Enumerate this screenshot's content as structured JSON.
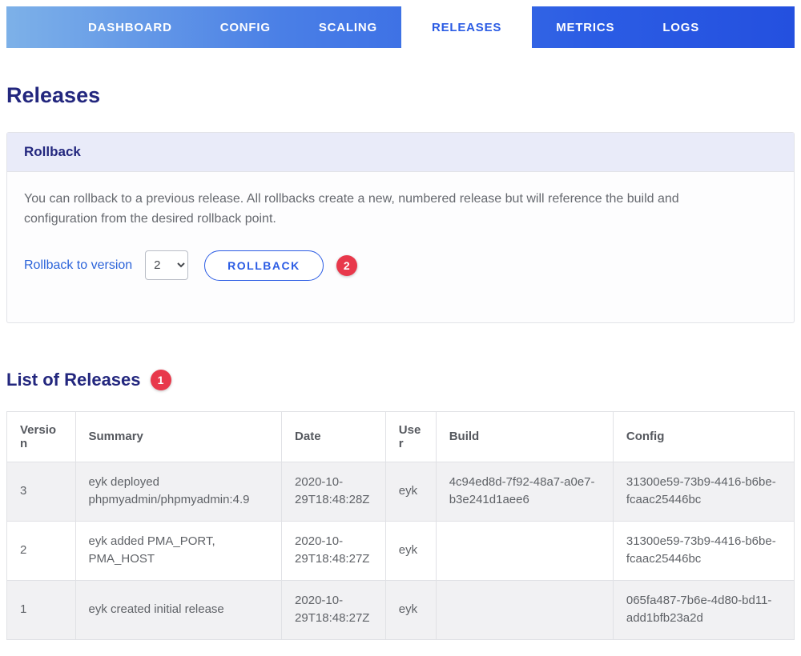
{
  "nav": {
    "items": [
      {
        "label": "DASHBOARD",
        "active": false
      },
      {
        "label": "CONFIG",
        "active": false
      },
      {
        "label": "SCALING",
        "active": false
      },
      {
        "label": "RELEASES",
        "active": true
      },
      {
        "label": "METRICS",
        "active": false
      },
      {
        "label": "LOGS",
        "active": false
      }
    ]
  },
  "page": {
    "title": "Releases"
  },
  "rollback_card": {
    "header": "Rollback",
    "description": "You can rollback to a previous release. All rollbacks create a new, numbered release but will reference the build and configuration from the desired rollback point.",
    "label": "Rollback to version",
    "selected_version": "2",
    "button_label": "ROLLBACK",
    "badge": "2"
  },
  "releases_section": {
    "title": "List of Releases",
    "badge": "1",
    "table": {
      "headers": [
        "Version",
        "Summary",
        "Date",
        "User",
        "Build",
        "Config"
      ],
      "rows": [
        {
          "version": "3",
          "summary": "eyk deployed phpmyadmin/phpmyadmin:4.9",
          "date": "2020-10-29T18:48:28Z",
          "user": "eyk",
          "build": "4c94ed8d-7f92-48a7-a0e7-b3e241d1aee6",
          "config": "31300e59-73b9-4416-b6be-fcaac25446bc"
        },
        {
          "version": "2",
          "summary": "eyk added PMA_PORT, PMA_HOST",
          "date": "2020-10-29T18:48:27Z",
          "user": "eyk",
          "build": "",
          "config": "31300e59-73b9-4416-b6be-fcaac25446bc"
        },
        {
          "version": "1",
          "summary": "eyk created initial release",
          "date": "2020-10-29T18:48:27Z",
          "user": "eyk",
          "build": "",
          "config": "065fa487-7b6e-4d80-bd11-add1bfb23a2d"
        }
      ]
    }
  },
  "colors": {
    "accent_blue": "#2b5ce4",
    "heading_navy": "#23277e",
    "badge_red": "#e8384b",
    "row_stripe": "#f1f1f3",
    "card_header_bg": "#e9ebf9"
  }
}
